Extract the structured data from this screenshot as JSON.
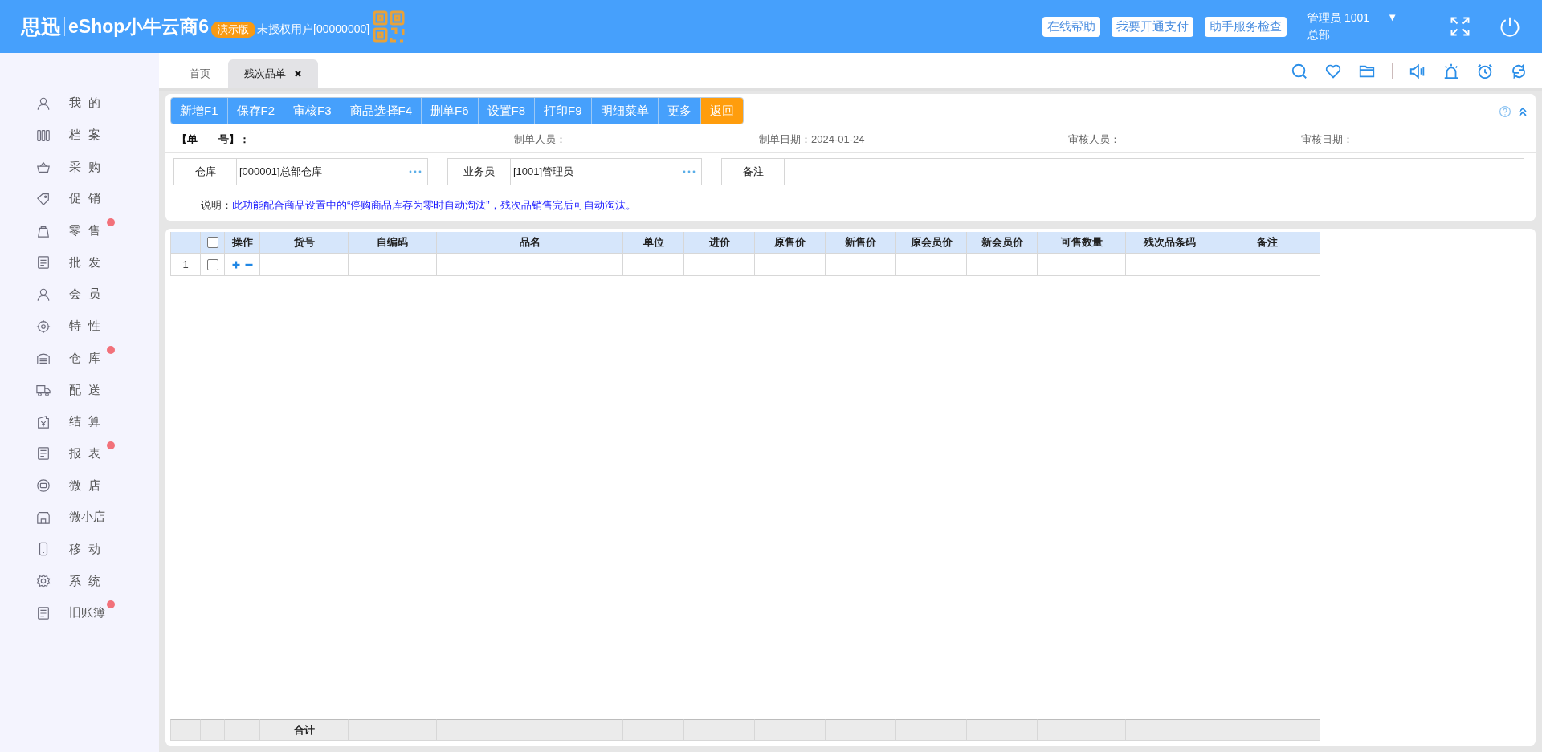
{
  "header": {
    "brand": "思迅",
    "product": "eShop小牛云商6",
    "edition": "演示版",
    "license": "未授权用户[00000000]",
    "links": [
      "在线帮助",
      "我要开通支付",
      "助手服务检查"
    ],
    "user": "管理员 1001",
    "user_caret": "▼",
    "branch": "总部"
  },
  "sidebar": {
    "items": [
      {
        "label": "我的",
        "badge": false
      },
      {
        "label": "档案",
        "badge": false
      },
      {
        "label": "采购",
        "badge": false
      },
      {
        "label": "促销",
        "badge": false
      },
      {
        "label": "零售",
        "badge": true
      },
      {
        "label": "批发",
        "badge": false
      },
      {
        "label": "会员",
        "badge": false
      },
      {
        "label": "特性",
        "badge": false
      },
      {
        "label": "仓库",
        "badge": true
      },
      {
        "label": "配送",
        "badge": false
      },
      {
        "label": "结算",
        "badge": false
      },
      {
        "label": "报表",
        "badge": true
      },
      {
        "label": "微店",
        "badge": false
      },
      {
        "label": "微小店",
        "badge": false
      },
      {
        "label": "移动",
        "badge": false
      },
      {
        "label": "系统",
        "badge": false
      },
      {
        "label": "旧账簿",
        "badge": true
      }
    ]
  },
  "tabs": [
    {
      "label": "首页",
      "selected": false,
      "closable": false
    },
    {
      "label": "残次品单",
      "selected": true,
      "closable": true
    }
  ],
  "toolbar": [
    {
      "label": "新增F1",
      "kind": "normal"
    },
    {
      "label": "保存F2",
      "kind": "normal"
    },
    {
      "label": "审核F3",
      "kind": "normal"
    },
    {
      "label": "商品选择F4",
      "kind": "normal"
    },
    {
      "label": "删单F6",
      "kind": "normal"
    },
    {
      "label": "设置F8",
      "kind": "normal"
    },
    {
      "label": "打印F9",
      "kind": "normal"
    },
    {
      "label": "明细菜单",
      "kind": "normal"
    },
    {
      "label": "更多",
      "kind": "normal"
    },
    {
      "label": "返回",
      "kind": "back"
    }
  ],
  "info": [
    {
      "label": "【单　　号】：",
      "bold": true
    },
    {
      "label": "制单人员：",
      "bold": false
    },
    {
      "label": "制单日期：2024-01-24",
      "bold": false
    },
    {
      "label": "审核人员：",
      "bold": false
    },
    {
      "label": "审核日期：",
      "bold": false
    }
  ],
  "fields": [
    {
      "label": "仓库",
      "value": "[000001]总部仓库",
      "picker": true
    },
    {
      "label": "业务员",
      "value": "[1001]管理员",
      "picker": true
    },
    {
      "label": "备注",
      "picker": false
    }
  ],
  "note": {
    "label": "说明：",
    "text": "此功能配合商品设置中的“停购商品库存为零时自动淘汰”，残次品销售完后可自动淘汰。"
  },
  "table": {
    "header_checked": false,
    "columns": [
      "操作",
      "货号",
      "自编码",
      "品名",
      "单位",
      "进价",
      "原售价",
      "新售价",
      "原会员价",
      "新会员价",
      "可售数量",
      "残次品条码",
      "备注"
    ],
    "rows": [
      {
        "number": "1",
        "checked": false
      }
    ],
    "footer": {
      "label": "合计"
    }
  }
}
